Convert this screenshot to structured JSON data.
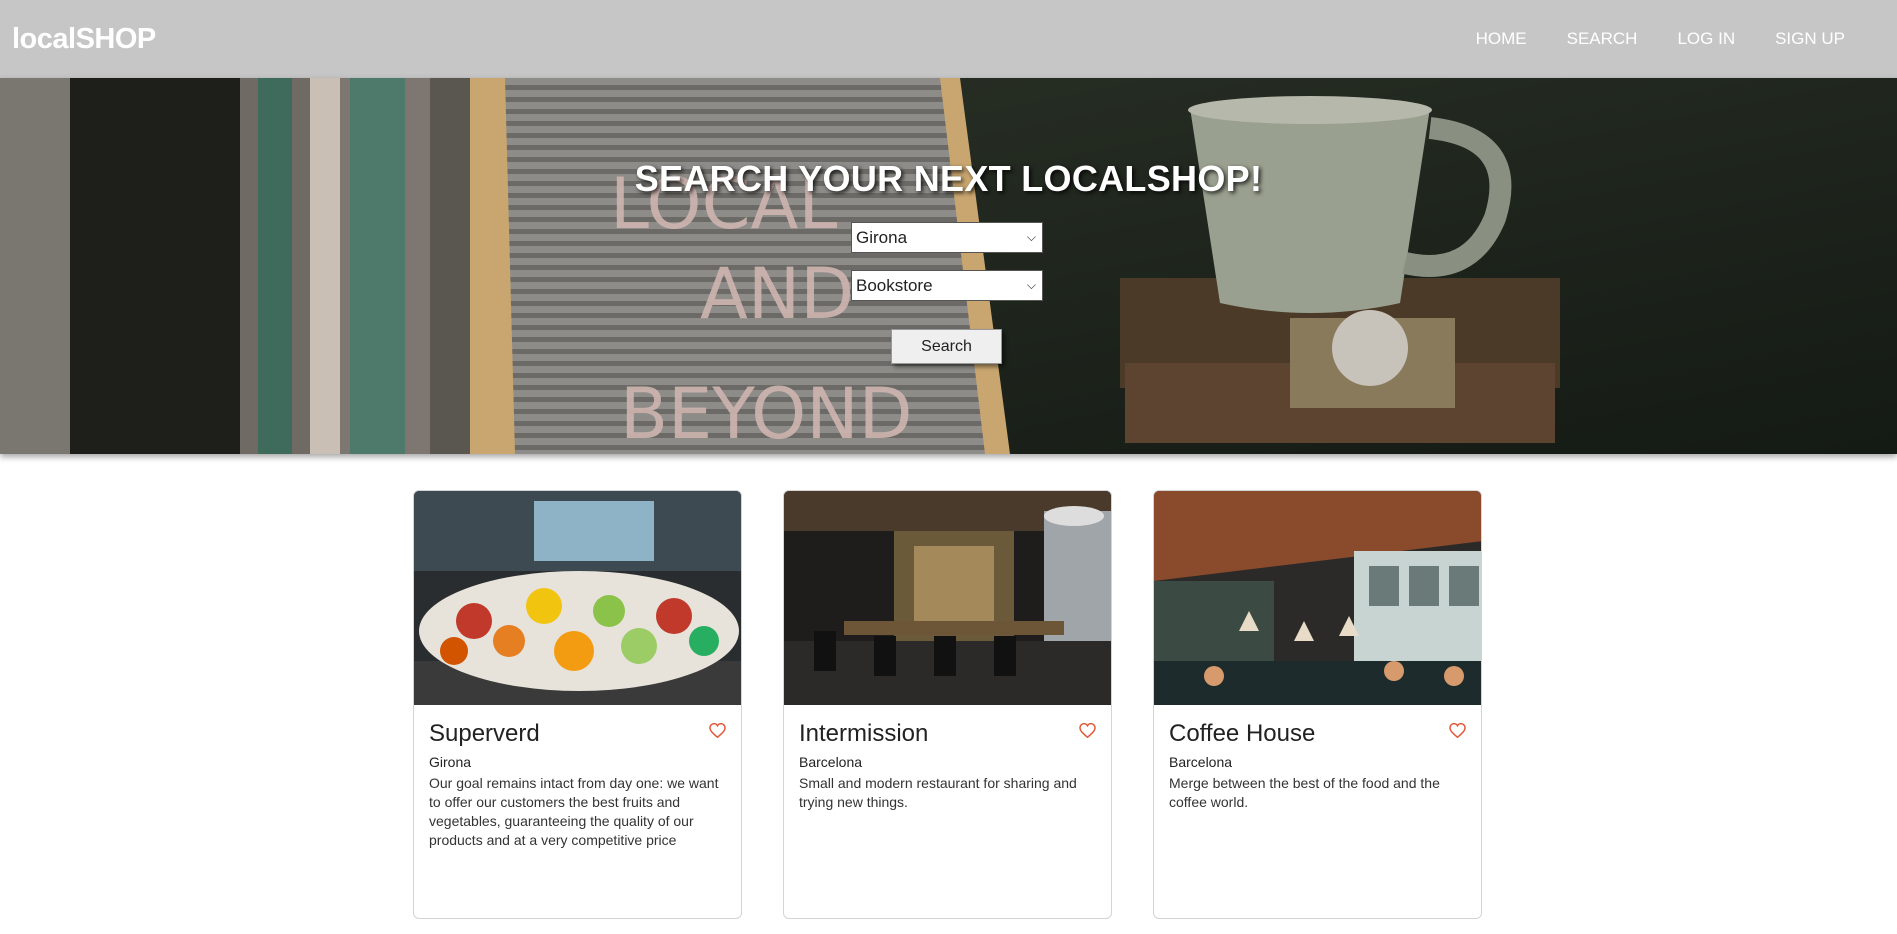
{
  "navbar": {
    "brand": "localSHOP",
    "links": [
      "HOME",
      "SEARCH",
      "LOG IN",
      "SIGN UP"
    ]
  },
  "hero": {
    "title": "SEARCH YOUR NEXT LOCALSHOP!",
    "city_select": "Girona",
    "category_select": "Bookstore",
    "search_button": "Search"
  },
  "cards": [
    {
      "name": "Superverd",
      "city": "Girona",
      "description": "Our goal remains intact from day one: we want to offer our customers the best fruits and vegetables, guaranteeing the quality of our products and at a very competitive price"
    },
    {
      "name": "Intermission",
      "city": "Barcelona",
      "description": "Small and modern restaurant for sharing and trying new things."
    },
    {
      "name": "Coffee House",
      "city": "Barcelona",
      "description": "Merge between the best of the food and the coffee world."
    }
  ],
  "colors": {
    "navbar_bg": "#c6c6c6",
    "heart": "#e05a3a"
  }
}
